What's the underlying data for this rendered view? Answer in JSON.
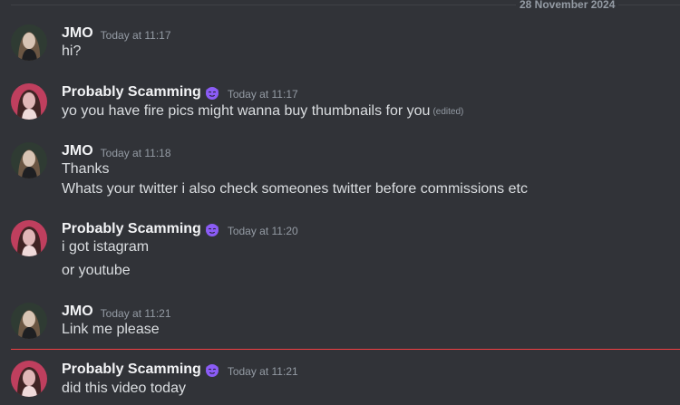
{
  "date_divider": "28 November 2024",
  "messages": [
    {
      "username": "JMO",
      "timestamp": "Today at 11:17",
      "lines": [
        "hi?"
      ]
    },
    {
      "username": "Probably Scamming",
      "timestamp": "Today at 11:17",
      "lines": [
        "yo you have fire pics might wanna buy thumbnails for you"
      ],
      "edited": "(edited)"
    },
    {
      "username": "JMO",
      "timestamp": "Today at 11:18",
      "lines": [
        "Thanks",
        "Whats your twitter i also check someones twitter before commissions etc"
      ]
    },
    {
      "username": "Probably Scamming",
      "timestamp": "Today at 11:20",
      "lines": [
        "i got istagram",
        "or youtube"
      ]
    },
    {
      "username": "JMO",
      "timestamp": "Today at 11:21",
      "lines": [
        "Link me please"
      ]
    },
    {
      "username": "Probably Scamming",
      "timestamp": "Today at 11:21",
      "lines": [
        "did this video today"
      ]
    }
  ],
  "colors": {
    "background": "#313338",
    "username": "#f2f3f5",
    "text": "#dbdee1",
    "muted": "#949ba4",
    "badge": "#8b5cf6",
    "new_message_divider": "#f23f43"
  },
  "icons": {
    "badge": "purple-devil-icon",
    "avatar_jmo": "avatar-jmo",
    "avatar_scam": "avatar-probably-scamming"
  }
}
